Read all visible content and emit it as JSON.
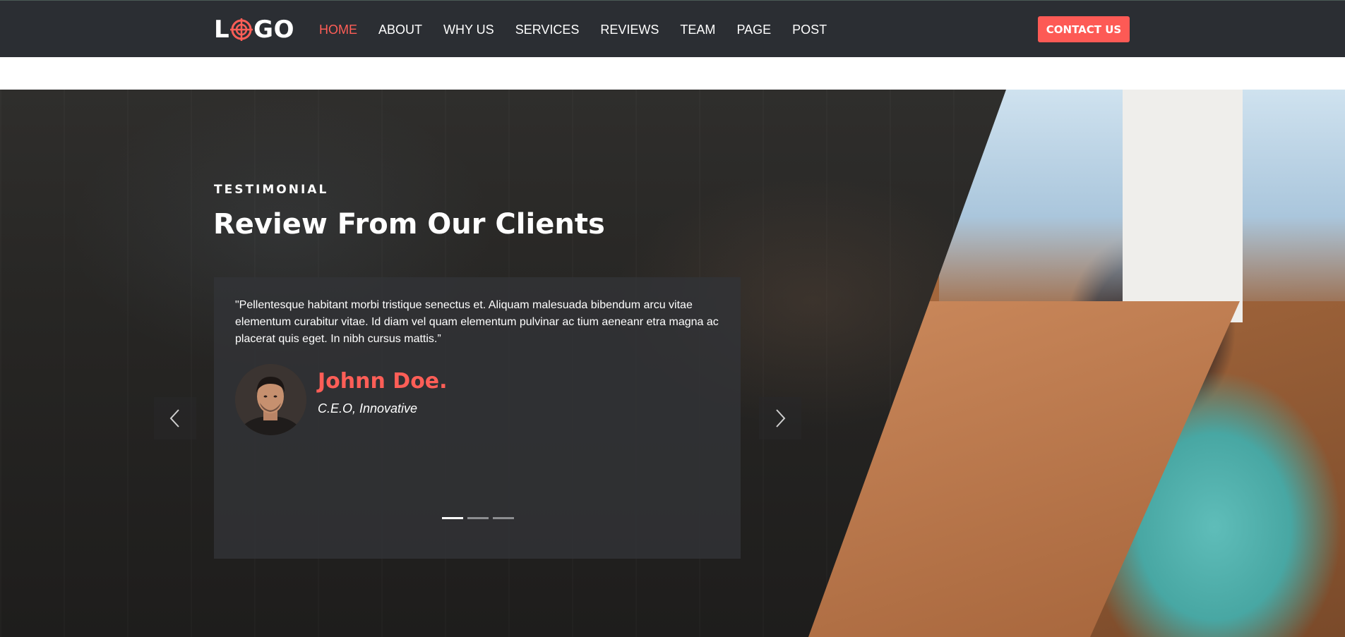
{
  "header": {
    "logo_text": {
      "left": "L",
      "right": "GO"
    },
    "nav": [
      {
        "label": "HOME",
        "active": true
      },
      {
        "label": "ABOUT",
        "active": false
      },
      {
        "label": "WHY US",
        "active": false
      },
      {
        "label": "SERVICES",
        "active": false
      },
      {
        "label": "REVIEWS",
        "active": false
      },
      {
        "label": "TEAM",
        "active": false
      },
      {
        "label": "PAGE",
        "active": false
      },
      {
        "label": "POST",
        "active": false
      }
    ],
    "contact_label": "CONTACT US"
  },
  "hero": {
    "eyebrow": "TESTIMONIAL",
    "title": "Review From Our Clients",
    "testimonial": {
      "quote": "\"Pellentesque habitant morbi tristique senectus et. Aliquam malesuada bibendum arcu vitae elementum curabitur vitae. Id diam vel quam elementum pulvinar ac tium aeneanr etra magna ac placerat quis eget. In nibh cursus mattis.”",
      "name": "Johnn Doe.",
      "role": "C.E.O, Innovative"
    },
    "slider": {
      "slides": 3,
      "active_index": 0
    },
    "icons": {
      "prev": "chevron-left-icon",
      "next": "chevron-right-icon",
      "avatar": "client-avatar"
    }
  },
  "colors": {
    "accent": "#fd5a55",
    "nav_bg": "#2b2e33",
    "card_bg": "#323337"
  }
}
